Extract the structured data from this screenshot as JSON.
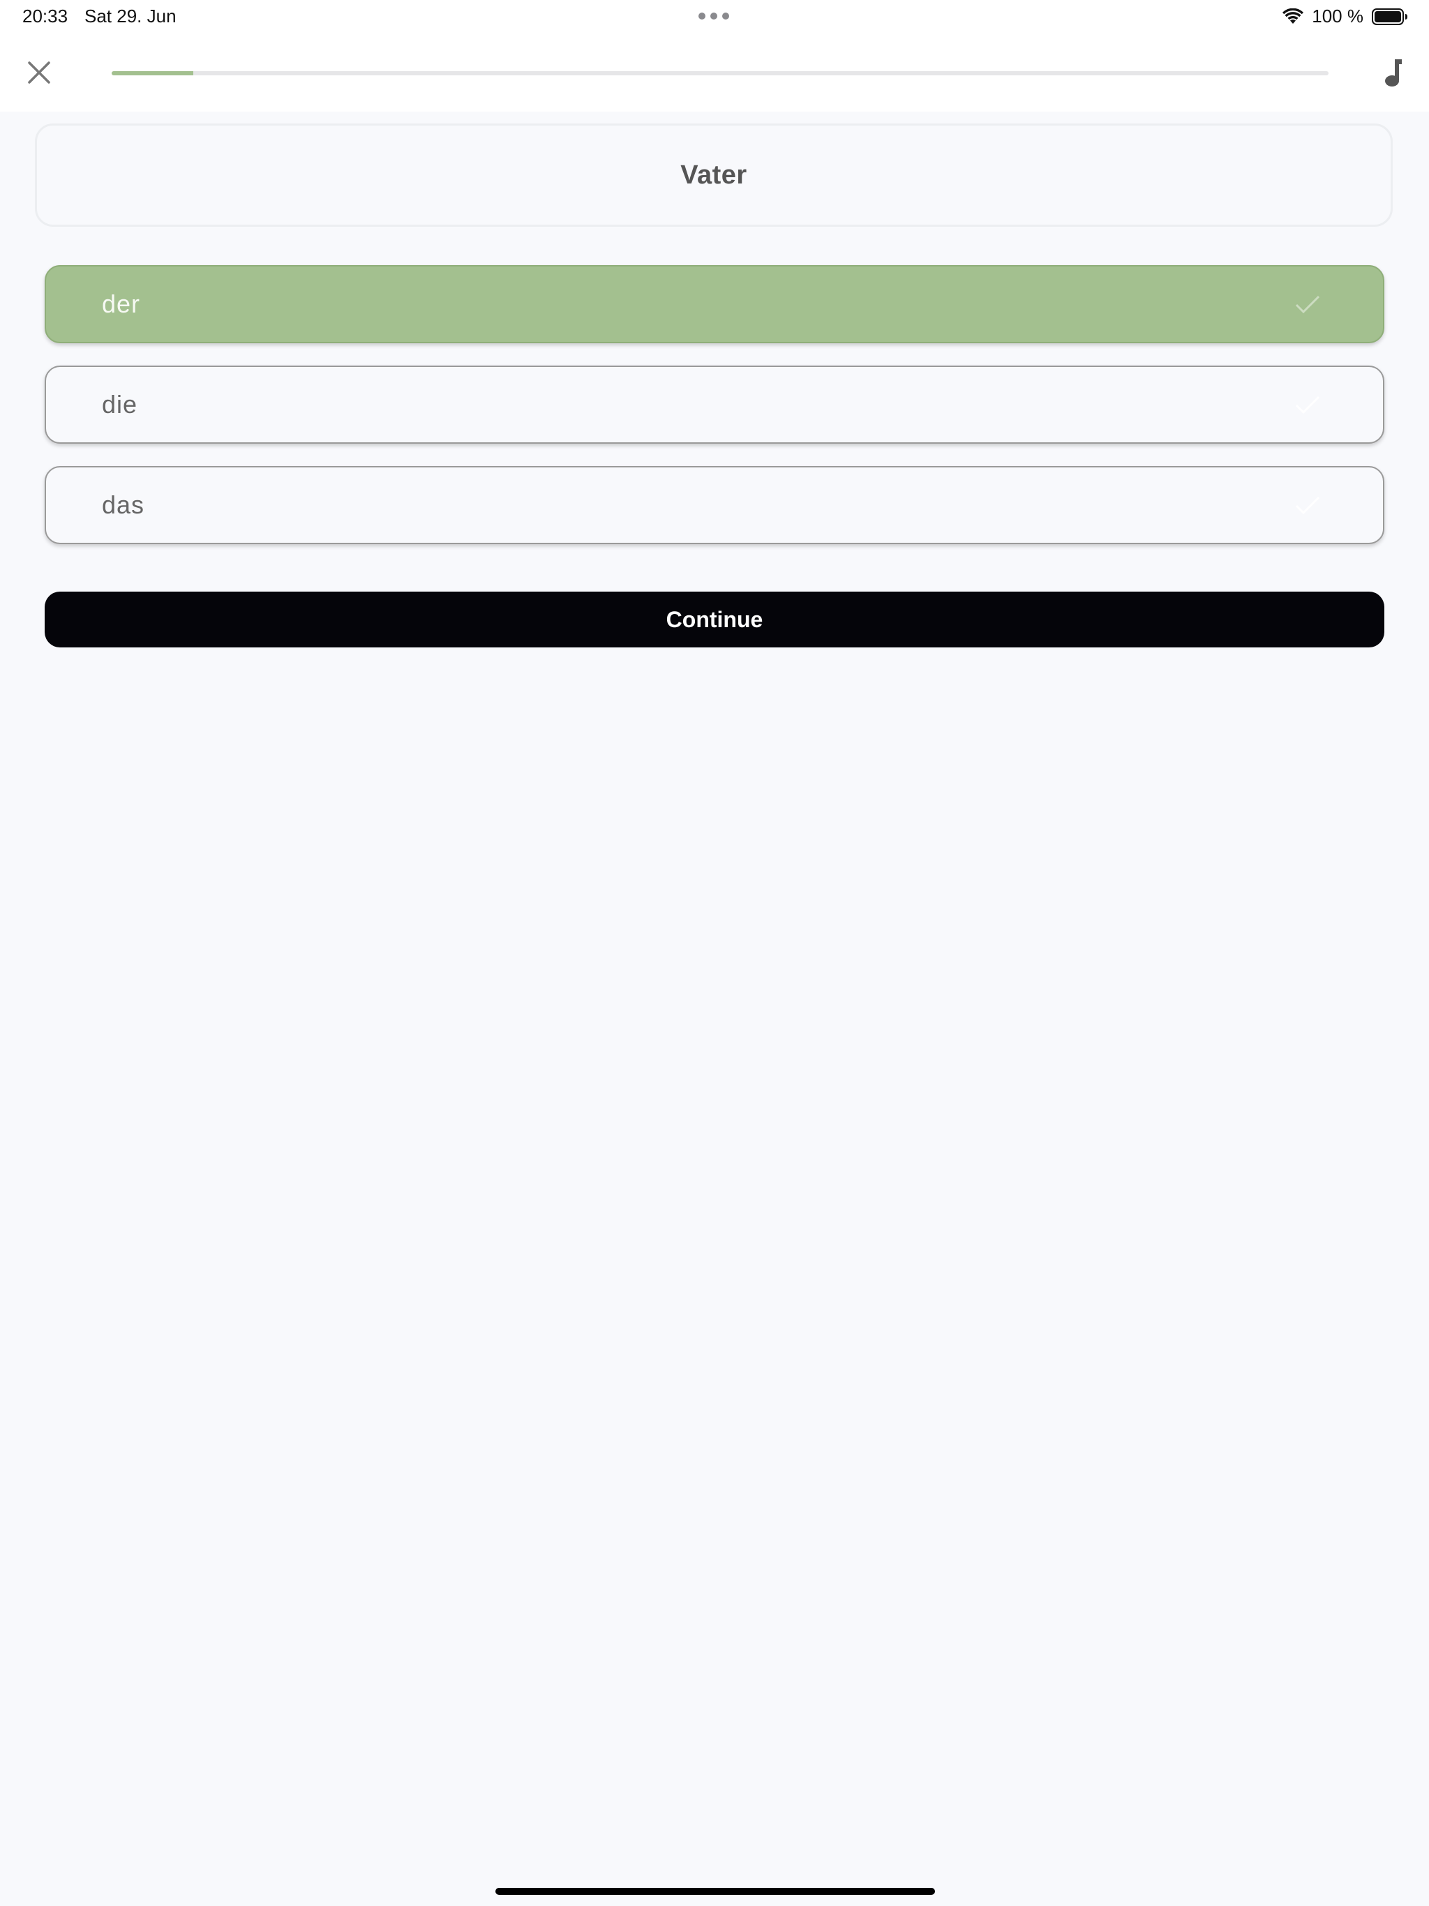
{
  "status_bar": {
    "time": "20:33",
    "date": "Sat 29. Jun",
    "battery_percent": "100 %",
    "icons": [
      "wifi-icon",
      "battery-icon",
      "more-dots-icon"
    ]
  },
  "top_bar": {
    "close_icon": "close-icon",
    "music_icon": "music-note-icon",
    "progress_fraction": 0.067
  },
  "quiz": {
    "word": "Vater",
    "options": [
      {
        "label": "der",
        "selected": true
      },
      {
        "label": "die",
        "selected": false
      },
      {
        "label": "das",
        "selected": false
      }
    ],
    "continue_label": "Continue"
  },
  "colors": {
    "accent_green": "#a3c08f",
    "button_black": "#05050a",
    "background": "#f8f9fc"
  }
}
